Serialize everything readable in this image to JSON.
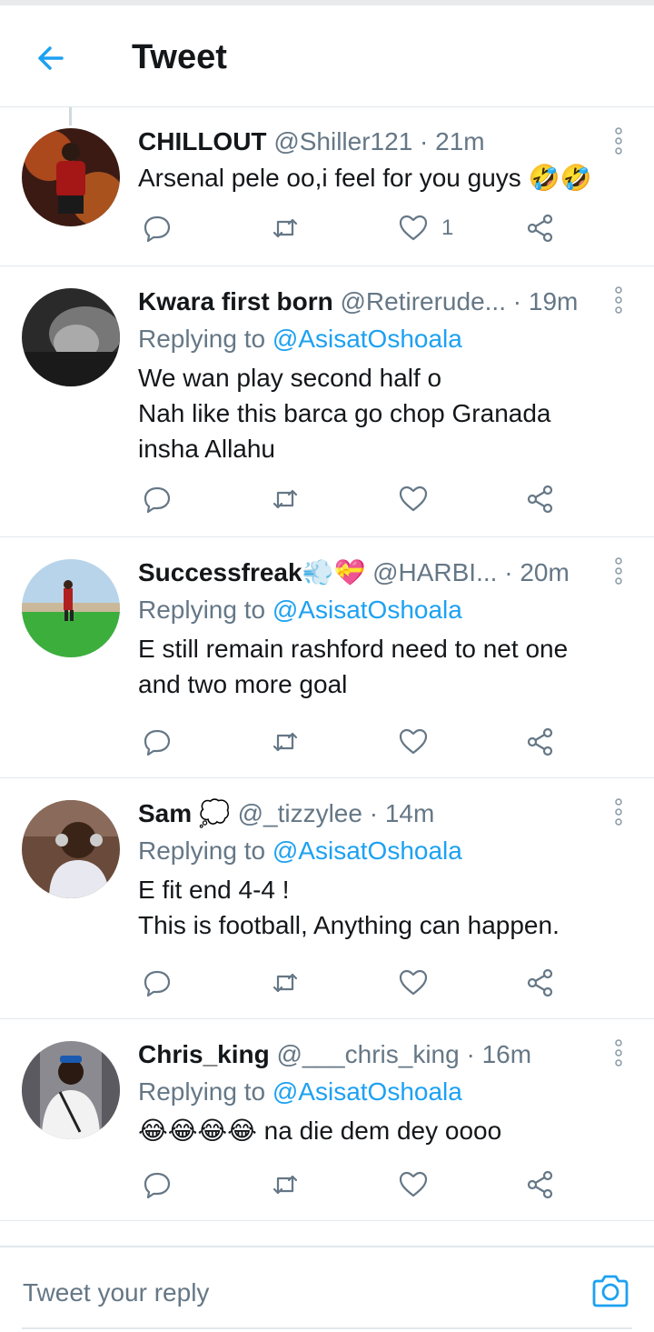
{
  "header": {
    "title": "Tweet"
  },
  "tweets": [
    {
      "name": "CHILLOUT",
      "handle": "@Shiller121",
      "time": "· 21m",
      "replying_prefix": "",
      "replying_to": "",
      "text": "Arsenal pele oo,i feel for you guys 🤣🤣",
      "likes": "1"
    },
    {
      "name": "Kwara first born",
      "handle": "@Retirerude...",
      "time": "· 19m",
      "replying_prefix": "Replying to",
      "replying_to": "@AsisatOshoala",
      "text": "We wan play second half o\nNah like this barca go chop Granada insha Allahu",
      "likes": ""
    },
    {
      "name": "Successfreak💨💝",
      "handle": "@HARBI...",
      "time": "· 20m",
      "replying_prefix": "Replying to",
      "replying_to": "@AsisatOshoala",
      "text": "E still remain rashford need to net one and two more goal",
      "likes": ""
    },
    {
      "name": "Sam 💭",
      "handle": "@_tizzylee",
      "time": "· 14m",
      "replying_prefix": "Replying to",
      "replying_to": "@AsisatOshoala",
      "text": "E fit end 4-4 !\nThis is football, Anything can happen.",
      "likes": ""
    },
    {
      "name": "Chris_king",
      "handle": "@___chris_king",
      "time": "· 16m",
      "replying_prefix": "Replying to",
      "replying_to": "@AsisatOshoala",
      "text": "😂😂😂😂 na die dem dey oooo",
      "likes": ""
    }
  ],
  "composer": {
    "placeholder": "Tweet your reply"
  },
  "colors": {
    "accent": "#1da1f2",
    "secondary_text": "#657786",
    "divider": "#e1e8ed"
  },
  "icons": [
    "back-arrow-icon",
    "more-vertical-icon",
    "reply-icon",
    "retweet-icon",
    "like-icon",
    "share-icon",
    "camera-icon"
  ]
}
